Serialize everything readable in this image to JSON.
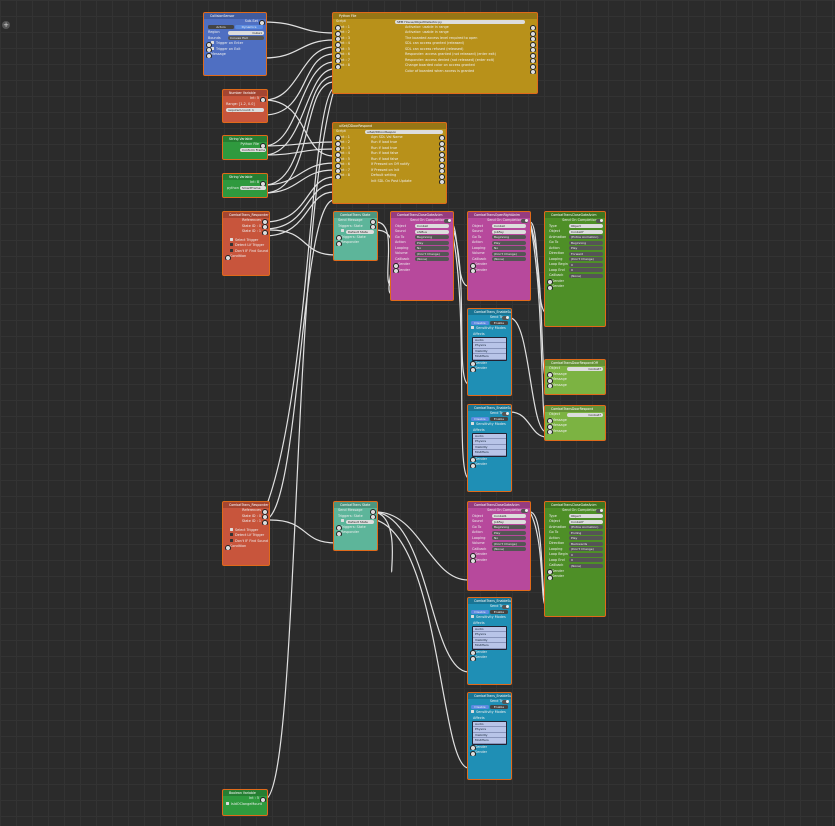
{
  "toolbar": {
    "add_label": "+"
  },
  "colors": {
    "orange": "#e06a1a",
    "blue": "#4f6fc2",
    "red": "#c8553c",
    "green": "#2f9a3e",
    "yellow": "#b8911a",
    "teal": "#5db59a",
    "magenta": "#b7499c",
    "lime": "#7cb342",
    "cyan": "#1f8fb5",
    "darkgreen": "#4e8f27"
  },
  "nodes": {
    "collision": {
      "title": "CollisionSensor",
      "subtitle": "Sub-Set",
      "mode_a": "Actors",
      "mode_b": "Dynamics",
      "region": "Region",
      "region_val": "Cube1",
      "bounds_label": "Bounds",
      "bounds_val": "Convex Hull",
      "trigger_enter": "Trigger on Enter",
      "trigger_exit": "Trigger on Exit",
      "message": "Message"
    },
    "number": {
      "title": "Number Variable",
      "value": "Int: 5",
      "range": "Range: [1-2, 0.0]",
      "req": "required.count: 1"
    },
    "str1": {
      "title": "String Variable",
      "label": "Python File",
      "value": "Conform Frame"
    },
    "str2": {
      "title": "String Variable",
      "label": "Int: 8",
      "value": "python",
      "val2": "SmartFrame"
    },
    "python": {
      "title": "Python File",
      "script_label": "Script",
      "script_val": "SEM House/ObjectDetector.py",
      "inputs": [
        "Int : 1",
        "Int : 2",
        "Int : 3",
        "Int : 4",
        "Int : 5",
        "Int : 6",
        "Int : 7",
        "Int : 8"
      ],
      "outputs": [
        "Activator: usable in range",
        "Activator: usable in range",
        "The boarded access level required to open",
        "SDL can access granted (released)",
        "SDL can access refused (released)",
        "Responder: access granted (not released) (enter exit)",
        "Responder: access denied (not released) (enter exit)",
        "Change boarded color on access granted",
        "Color of boarded when access is granted"
      ]
    },
    "python2": {
      "title": "uiSet/DDoorRespond",
      "script_label": "Script",
      "script_val": "uiSet/DDoorRespon",
      "inputs": [
        "Int : 1",
        "Int : 2",
        "Int : 3",
        "Int : 4",
        "Int : 5",
        "Int : 6",
        "Int : 7",
        "Int : 8"
      ],
      "outputs": [
        "Agn SDL Val Name",
        "Run if load true",
        "Run if load true",
        "Run if load false",
        "Run if load false",
        "If Pressed on Off notify",
        "If Pressed on Init",
        "Default setting",
        "Init SDL On Post Update"
      ]
    },
    "resp1": {
      "title": "CombatTrans_Responder",
      "references": "References",
      "s1": "State ID : 0",
      "s2": "State ID : 1",
      "opts": [
        "Select Trigger",
        "Detect Lif Trigger",
        "Don't IF Find Sound",
        "Condition"
      ]
    },
    "resp2": {
      "title": "CombatTrans_Responder",
      "references": "References",
      "s1": "State ID : 0",
      "s2": "State ID : 1",
      "opts": [
        "Select Trigger",
        "Detect Lif Trigger",
        "Don't IF Find Sound",
        "Condition"
      ]
    },
    "state1": {
      "title": "CombatTrans State",
      "r1": "Send Message",
      "r2": "Triggers: State",
      "r3": "Default State",
      "r4": "Triggers: State",
      "r5": "Responder"
    },
    "state2": {
      "title": "CombatTrans State",
      "r1": "Send Message",
      "r2": "Triggers: State",
      "r3": "Default State",
      "r4": "Triggers: State",
      "r5": "Responder"
    },
    "anim1": {
      "title": "CombatTransCloseGateAnim",
      "head": "Send On Completion",
      "rows": [
        [
          "Object",
          "Conbat"
        ],
        [
          "Sound",
          "sfxBus"
        ],
        [
          "Go To",
          "Beginning"
        ],
        [
          "Action",
          "Play"
        ],
        [
          "Looping",
          "No"
        ],
        [
          "Volume",
          "(Don't Change)"
        ],
        [
          "Callback",
          "(None)"
        ]
      ],
      "s1": "Sender",
      "s2": "Sender"
    },
    "anim2": {
      "title": "CombatTransOpenRightAnim",
      "head": "Send On Completion",
      "rows": [
        [
          "Object",
          "Conbat"
        ],
        [
          "Sound",
          "JobFey"
        ],
        [
          "Go To",
          "Beginning"
        ],
        [
          "Action",
          "Play"
        ],
        [
          "Looping",
          "No"
        ],
        [
          "Volume",
          "(Don't Change)"
        ],
        [
          "Callback",
          "(None)"
        ]
      ],
      "s1": "Sender",
      "s2": "Sender"
    },
    "anim3": {
      "title": "CombatTransCloseGateAnim",
      "head": "Send On Completion",
      "rows": [
        [
          "Object",
          "Conbat1"
        ],
        [
          "Sound",
          "JobFey"
        ],
        [
          "Go To",
          "Beginning"
        ],
        [
          "Action",
          "Play"
        ],
        [
          "Looping",
          "No"
        ],
        [
          "Volume",
          "(Don't Change)"
        ],
        [
          "Callback",
          "(None)"
        ]
      ],
      "s1": "Sender",
      "s2": "Sender"
    },
    "ctrl1": {
      "title": "CombatTransCloseGateAnim",
      "head": "Send On Completion",
      "rows": [
        [
          "Type",
          "Object"
        ],
        [
          "Object",
          "Conbat7"
        ],
        [
          "Animation",
          "(Entire Animation)"
        ],
        [
          "Go To",
          "Beginning"
        ],
        [
          "Action",
          "Play"
        ],
        [
          "Direction",
          "Forward"
        ],
        [
          "Looping",
          "(Don't Change)"
        ],
        [
          "Loop Begin",
          "0"
        ],
        [
          "Loop End",
          "0"
        ],
        [
          "Callback",
          "(None)"
        ]
      ],
      "s1": "Sender",
      "s2": "Sender"
    },
    "ctrl2": {
      "title": "CombatTransCloseGateAnim",
      "head": "Send On Completion",
      "rows": [
        [
          "Type",
          "Object"
        ],
        [
          "Object",
          "Conbat7"
        ],
        [
          "Animation",
          "(Entire Animation)"
        ],
        [
          "Go To",
          "Ending"
        ],
        [
          "Action",
          "Play"
        ],
        [
          "Direction",
          "Backwards"
        ],
        [
          "Looping",
          "(Don't Change)"
        ],
        [
          "Loop Begin",
          "0"
        ],
        [
          "Loop End",
          "0"
        ],
        [
          "Callback",
          "(None)"
        ]
      ],
      "s1": "Sender",
      "s2": "Sender"
    },
    "msg1": {
      "title": "CombatTransDoorRespondOff",
      "object": "Object",
      "object_val": "Conbat7",
      "m": [
        "Message",
        "Message",
        "Message"
      ]
    },
    "msg2": {
      "title": "CombatTransDoorRespond",
      "object": "Object",
      "object_val": "Conbat7",
      "m": [
        "Message",
        "Message",
        "Message"
      ]
    },
    "enable1": {
      "title": "CombatTrans_EnableSub",
      "send": "Send To",
      "dis": "Disable",
      "en": "Enable",
      "sens": "Sensitivity Modes",
      "affects": "Affects",
      "list": [
        "Audio",
        "Physics",
        "Visibility",
        "Modifiers"
      ],
      "s1": "Sender",
      "s2": "Sender"
    },
    "enable2": {
      "title": "CombatTrans_EnableSub",
      "send": "Send To",
      "dis": "Disable",
      "en": "Enable",
      "sens": "Sensitivity Modes",
      "affects": "Affects",
      "list": [
        "Audio",
        "Physics",
        "Visibility",
        "Modifiers"
      ],
      "s1": "Sender",
      "s2": "Sender"
    },
    "enable3": {
      "title": "CombatTrans_EnableSub",
      "send": "Send To",
      "dis": "Disable",
      "en": "Enable",
      "sens": "Sensitivity Modes",
      "affects": "Affects",
      "list": [
        "Audio",
        "Physics",
        "Visibility",
        "Modifiers"
      ],
      "s1": "Sender",
      "s2": "Sender"
    },
    "enable4": {
      "title": "CombatTrans_EnableSub",
      "send": "Send To",
      "dis": "Disable",
      "en": "Enable",
      "sens": "Sensitivity Modes",
      "affects": "Affects",
      "list": [
        "Audio",
        "Physics",
        "Visibility",
        "Modifiers"
      ],
      "s1": "Sender",
      "s2": "Sender"
    },
    "bottom": {
      "title": "Boolean Variable",
      "value": "Int : 5",
      "check": "IsIdOClangeMount"
    }
  }
}
